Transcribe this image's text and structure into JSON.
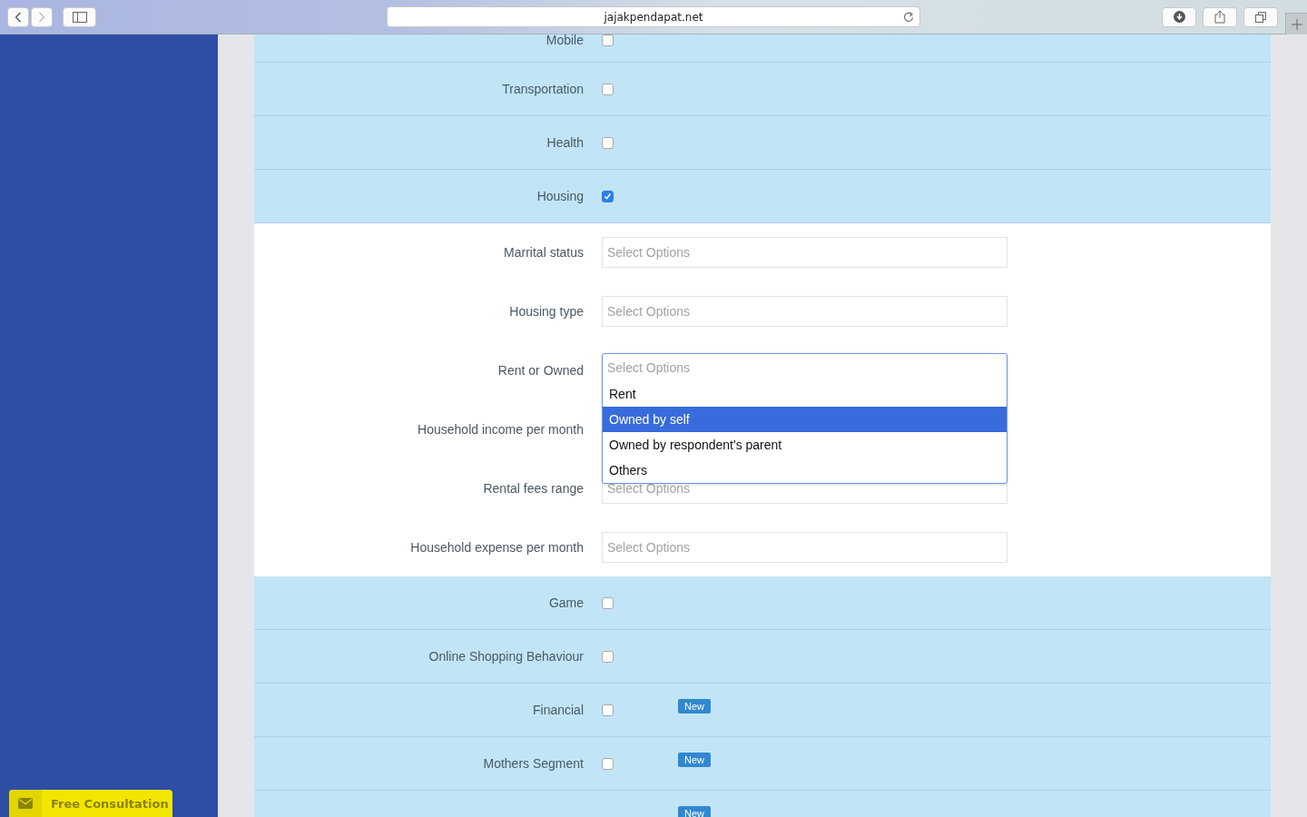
{
  "browser": {
    "url": "jajakpendapat.net"
  },
  "rows_top": [
    {
      "label": "Mobile",
      "checked": false
    },
    {
      "label": "Transportation",
      "checked": false
    },
    {
      "label": "Health",
      "checked": false
    },
    {
      "label": "Housing",
      "checked": true
    }
  ],
  "housing_fields": [
    {
      "label": "Marrital status",
      "placeholder": "Select Options"
    },
    {
      "label": "Housing type",
      "placeholder": "Select Options"
    },
    {
      "label": "Rent or Owned",
      "placeholder": "Select Options",
      "open": true,
      "options": [
        {
          "label": "Rent",
          "selected": false
        },
        {
          "label": "Owned by self",
          "selected": true
        },
        {
          "label": "Owned by respondent's parent",
          "selected": false
        },
        {
          "label": "Others",
          "selected": false
        }
      ]
    },
    {
      "label": "Household income per month"
    },
    {
      "label": "Rental fees range",
      "placeholder": "Select Options"
    },
    {
      "label": "Household expense per month",
      "placeholder": "Select Options"
    }
  ],
  "rows_bottom": [
    {
      "label": "Game",
      "checked": false
    },
    {
      "label": "Online Shopping Behaviour",
      "checked": false
    },
    {
      "label": "Financial",
      "checked": false,
      "badge": "New"
    },
    {
      "label": "Mothers Segment",
      "checked": false,
      "badge": "New"
    },
    {
      "badge": "New"
    }
  ],
  "consultation_button": "Free Consultation"
}
